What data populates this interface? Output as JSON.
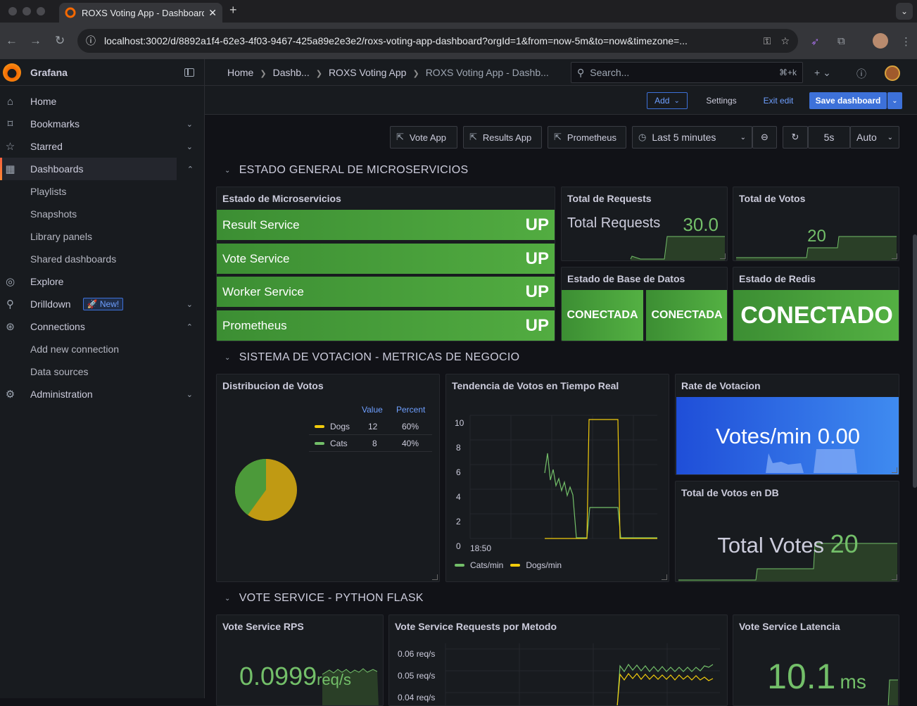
{
  "browser": {
    "tab_title": "ROXS Voting App - Dashboard",
    "url": "localhost:3002/d/8892a1f4-62e3-4f03-9467-425a89e2e3e2/roxs-voting-app-dashboard?orgId=1&from=now-5m&to=now&timezone=..."
  },
  "sidebar": {
    "brand": "Grafana",
    "items": [
      {
        "label": "Home",
        "icon": "home-icon"
      },
      {
        "label": "Bookmarks",
        "icon": "bookmark-icon"
      },
      {
        "label": "Starred",
        "icon": "star-icon"
      },
      {
        "label": "Dashboards",
        "icon": "dashboards-icon"
      },
      {
        "label": "Playlists"
      },
      {
        "label": "Snapshots"
      },
      {
        "label": "Library panels"
      },
      {
        "label": "Shared dashboards"
      },
      {
        "label": "Explore",
        "icon": "compass-icon"
      },
      {
        "label": "Drilldown",
        "icon": "drilldown-icon",
        "badge": "New!"
      },
      {
        "label": "Connections",
        "icon": "connections-icon"
      },
      {
        "label": "Add new connection"
      },
      {
        "label": "Data sources"
      },
      {
        "label": "Administration",
        "icon": "cog-icon"
      }
    ]
  },
  "topbar": {
    "breadcrumbs": [
      "Home",
      "Dashb...",
      "ROXS Voting App",
      "ROXS Voting App - Dashb..."
    ],
    "search_placeholder": "Search...",
    "search_shortcut": "⌘+k"
  },
  "editbar": {
    "add": "Add",
    "settings": "Settings",
    "exit_edit": "Exit edit",
    "save": "Save dashboard"
  },
  "controls": {
    "links": [
      "Vote App",
      "Results App",
      "Prometheus"
    ],
    "time_range": "Last 5 minutes",
    "refresh_interval": "5s",
    "auto": "Auto"
  },
  "rows": [
    "ESTADO GENERAL DE MICROSERVICIOS",
    "SISTEMA DE VOTACION - METRICAS DE NEGOCIO",
    "VOTE SERVICE - PYTHON FLASK"
  ],
  "panels": {
    "micro": {
      "title": "Estado de Microservicios",
      "services": [
        {
          "name": "Result Service",
          "status": "UP"
        },
        {
          "name": "Vote Service",
          "status": "UP"
        },
        {
          "name": "Worker Service",
          "status": "UP"
        },
        {
          "name": "Prometheus",
          "status": "UP"
        }
      ]
    },
    "total_requests": {
      "title": "Total de Requests",
      "label": "Total Requests",
      "value": "30.0"
    },
    "total_votos": {
      "title": "Total de Votos",
      "value": "20"
    },
    "db": {
      "title": "Estado de Base de Datos",
      "values": [
        "CONECTADA",
        "CONECTADA"
      ]
    },
    "redis": {
      "title": "Estado de Redis",
      "value": "CONECTADO"
    },
    "distribucion": {
      "title": "Distribucion de Votos",
      "col_value": "Value",
      "col_percent": "Percent",
      "rows": [
        {
          "name": "Dogs",
          "value": "12",
          "percent": "60%",
          "color": "#d5a60c"
        },
        {
          "name": "Cats",
          "value": "8",
          "percent": "40%",
          "color": "#56a64b"
        }
      ]
    },
    "tendencia": {
      "title": "Tendencia de Votos en Tiempo Real",
      "y_ticks": [
        "10",
        "8",
        "6",
        "4",
        "2",
        "0"
      ],
      "x_tick": "18:50",
      "legend": [
        "Cats/min",
        "Dogs/min"
      ]
    },
    "rate": {
      "title": "Rate de Votacion",
      "label": "Votes/min",
      "value": "0.00"
    },
    "total_db": {
      "title": "Total de Votos en DB",
      "label": "Total Votes",
      "value": "20"
    },
    "vote_rps": {
      "title": "Vote Service RPS",
      "value": "0.0999",
      "unit": "req/s"
    },
    "vote_metodo": {
      "title": "Vote Service Requests por Metodo",
      "y_ticks": [
        "0.06 req/s",
        "0.05 req/s",
        "0.04 req/s"
      ]
    },
    "vote_latencia": {
      "title": "Vote Service Latencia",
      "value": "10.1",
      "unit": "ms"
    }
  },
  "colors": {
    "green": "#73bf69",
    "yellow": "#d5a60c",
    "blue": "#3d71d9",
    "orange": "#f46800"
  }
}
